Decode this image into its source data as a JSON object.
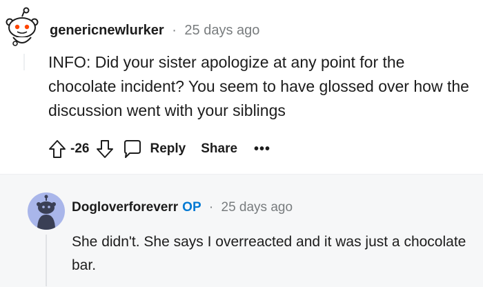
{
  "comment": {
    "username": "genericnewlurker",
    "separator": "·",
    "time": "25 days ago",
    "body": "INFO: Did your sister apologize at any point for the chocolate incident? You seem to have glossed over how the discussion went with your siblings",
    "score": "-26",
    "reply_label": "Reply",
    "share_label": "Share",
    "more_label": "•••"
  },
  "reply": {
    "username": "Dogloverforeverr",
    "op_badge": "OP",
    "separator": "·",
    "time": "25 days ago",
    "body": "She didn't. She says I overreacted and it was just a chocolate bar."
  },
  "colors": {
    "op": "#0079d3",
    "meta": "#787c7e",
    "reply_bg": "#f6f7f8",
    "avatar2_bg": "#a9b6ea",
    "snoo_orange": "#ff4500"
  }
}
